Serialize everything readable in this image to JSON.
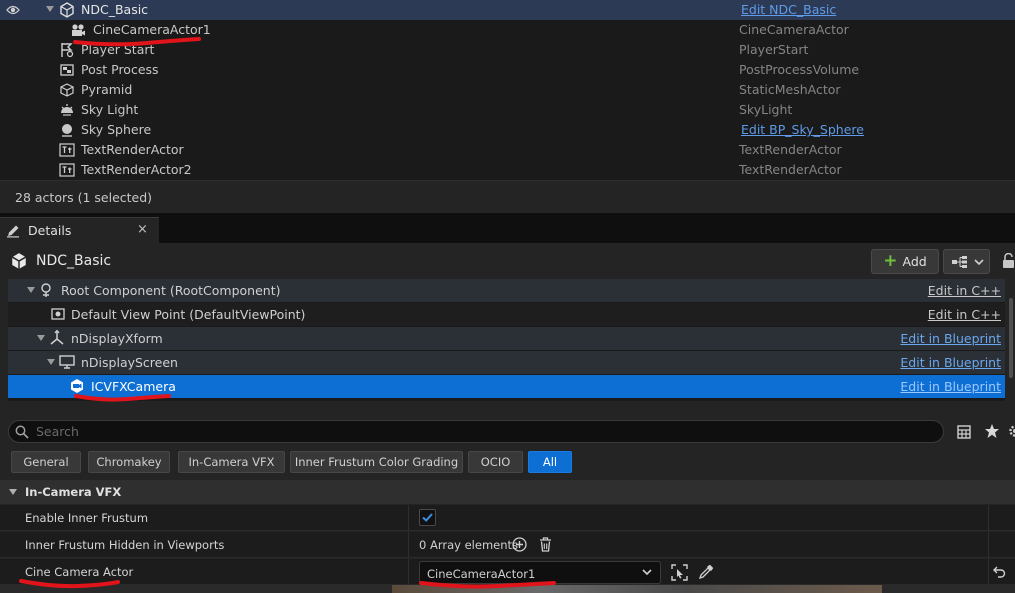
{
  "outliner": {
    "rows": [
      {
        "name": "NDC_Basic",
        "type": "Edit NDC_Basic",
        "type_is_link": true,
        "selected": true,
        "icon": "ndisplay-actor-icon"
      },
      {
        "name": "CineCameraActor1",
        "type": "CineCameraActor",
        "type_is_link": false,
        "icon": "cine-camera-icon"
      },
      {
        "name": "Player Start",
        "type": "PlayerStart",
        "type_is_link": false,
        "icon": "player-start-icon"
      },
      {
        "name": "Post Process",
        "type": "PostProcessVolume",
        "type_is_link": false,
        "icon": "post-process-icon"
      },
      {
        "name": "Pyramid",
        "type": "StaticMeshActor",
        "type_is_link": false,
        "icon": "static-mesh-icon"
      },
      {
        "name": "Sky Light",
        "type": "SkyLight",
        "type_is_link": false,
        "icon": "sky-light-icon"
      },
      {
        "name": "Sky Sphere",
        "type": "Edit BP_Sky_Sphere",
        "type_is_link": true,
        "icon": "sky-sphere-icon"
      },
      {
        "name": "TextRenderActor",
        "type": "TextRenderActor",
        "type_is_link": false,
        "icon": "text-render-icon"
      },
      {
        "name": "TextRenderActor2",
        "type": "TextRenderActor",
        "type_is_link": false,
        "icon": "text-render-icon"
      }
    ],
    "footer": "28 actors (1 selected)"
  },
  "details": {
    "tab_label": "Details",
    "tab_close": "×",
    "actor_name": "NDC_Basic",
    "add_label": "Add",
    "components": [
      {
        "name": "Root Component (RootComponent)",
        "edit": "Edit in C++",
        "icon": "root-component-icon"
      },
      {
        "name": "Default View Point (DefaultViewPoint)",
        "edit": "Edit in C++",
        "icon": "view-point-icon"
      },
      {
        "name": "nDisplayXform",
        "edit": "Edit in Blueprint",
        "icon": "xform-icon"
      },
      {
        "name": "nDisplayScreen",
        "edit": "Edit in Blueprint",
        "icon": "screen-icon"
      },
      {
        "name": "ICVFXCamera",
        "edit": "Edit in Blueprint",
        "icon": "icvfx-camera-icon",
        "selected": true
      }
    ],
    "search_placeholder": "Search",
    "filters": [
      {
        "label": "General",
        "active": false
      },
      {
        "label": "Chromakey",
        "active": false
      },
      {
        "label": "In-Camera VFX",
        "active": false
      },
      {
        "label": "Inner Frustum Color Grading",
        "active": false
      },
      {
        "label": "OCIO",
        "active": false
      },
      {
        "label": "All",
        "active": true
      }
    ],
    "category": "In-Camera VFX",
    "properties": {
      "enable_inner_frustum": {
        "label": "Enable Inner Frustum",
        "checked": true
      },
      "hidden_in_viewports": {
        "label": "Inner Frustum Hidden in Viewports",
        "value": "0 Array elements"
      },
      "cine_camera_actor": {
        "label": "Cine Camera Actor",
        "value": "CineCameraActor1"
      }
    }
  },
  "colors": {
    "selection_blue": "#0d6fd4",
    "outliner_selected": "#2d3a55",
    "link_blue": "#5f9be8",
    "annotation_red": "#e0141a",
    "add_green": "#6fbf3d"
  }
}
